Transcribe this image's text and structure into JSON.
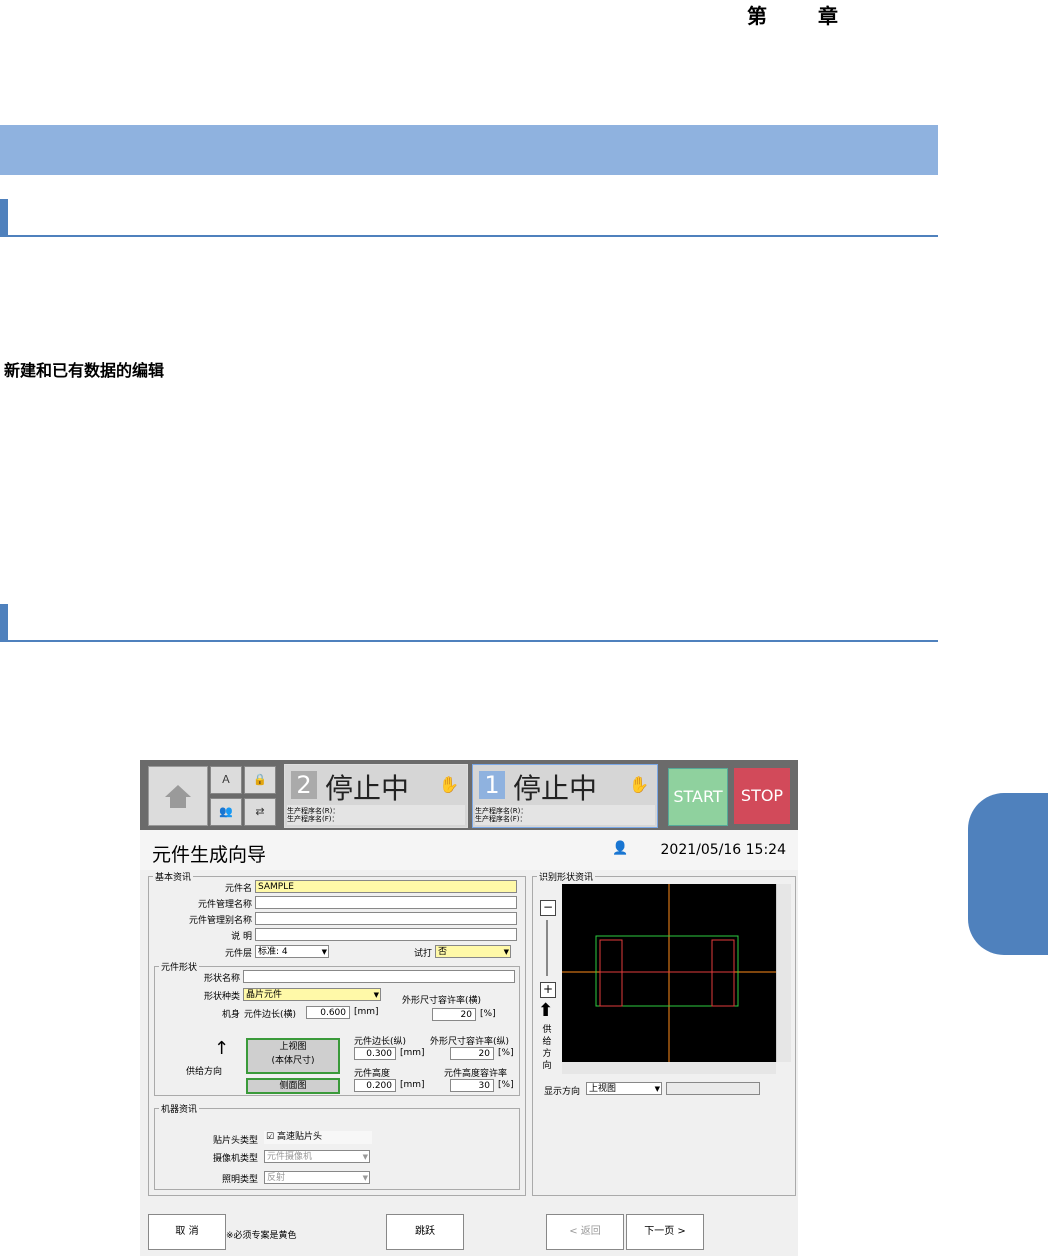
{
  "doc": {
    "chapter": "第 章",
    "heading": "新建和已有数据的编辑"
  },
  "shot": {
    "status1_num": "2",
    "status1_text": "停止中",
    "status2_num": "1",
    "status2_text": "停止中",
    "prog_r": "生产程序名(R)：",
    "prog_f": "生产程序名(F)：",
    "start": "START",
    "stop": "STOP",
    "title": "元件生成向导",
    "datetime": "2021/05/16 15:24",
    "basic_group": "基本资讯",
    "lbl_name": "元件名",
    "val_name": "SAMPLE",
    "lbl_mgmt": "元件管理名称",
    "lbl_mgmt2": "元件管理别名称",
    "lbl_desc": "说 明",
    "lbl_layer": "元件层",
    "val_layer": "标准: 4",
    "lbl_trial": "试打",
    "val_trial": "否",
    "shape_group": "元件形状",
    "lbl_shape_name": "形状名称",
    "lbl_shape_type": "形状种类",
    "val_shape_type": "晶片元件",
    "lbl_tol_h": "外形尺寸容许率(横)",
    "lbl_model": "机身",
    "lbl_len_h": "元件边长(横)",
    "val_len_h": "0.600",
    "unit_mm": "[mm]",
    "val_tol_h": "20",
    "unit_pct": "[%]",
    "top_view": "上视图",
    "body_size": "(本体尺寸)",
    "side_view": "侧面图",
    "feed_dir": "供给方向",
    "lbl_len_v": "元件边长(纵)",
    "val_len_v": "0.300",
    "lbl_tol_v": "外形尺寸容许率(纵)",
    "val_tol_v": "20",
    "lbl_height": "元件高度",
    "val_height": "0.200",
    "lbl_tol_height": "元件高度容许率",
    "val_tol_height": "30",
    "machine_group": "机器资讯",
    "lbl_head": "贴片头类型",
    "val_head": "高速贴片头",
    "lbl_camera": "摄像机类型",
    "val_camera": "元件摄像机",
    "lbl_light": "照明类型",
    "val_light": "反射",
    "recog_group": "识别形状资讯",
    "feed_vertical": "供给方向",
    "lbl_display_dir": "显示方向",
    "val_display_dir": "上视图",
    "btn_cancel": "取 消",
    "note_required": "※必须专案是黄色",
    "btn_skip": "跳跃",
    "btn_back": "< 返回",
    "btn_next": "下一页 >"
  },
  "colors": {
    "accent": "#4f81bd",
    "band": "#8fb2df",
    "required": "#fff9a8"
  }
}
